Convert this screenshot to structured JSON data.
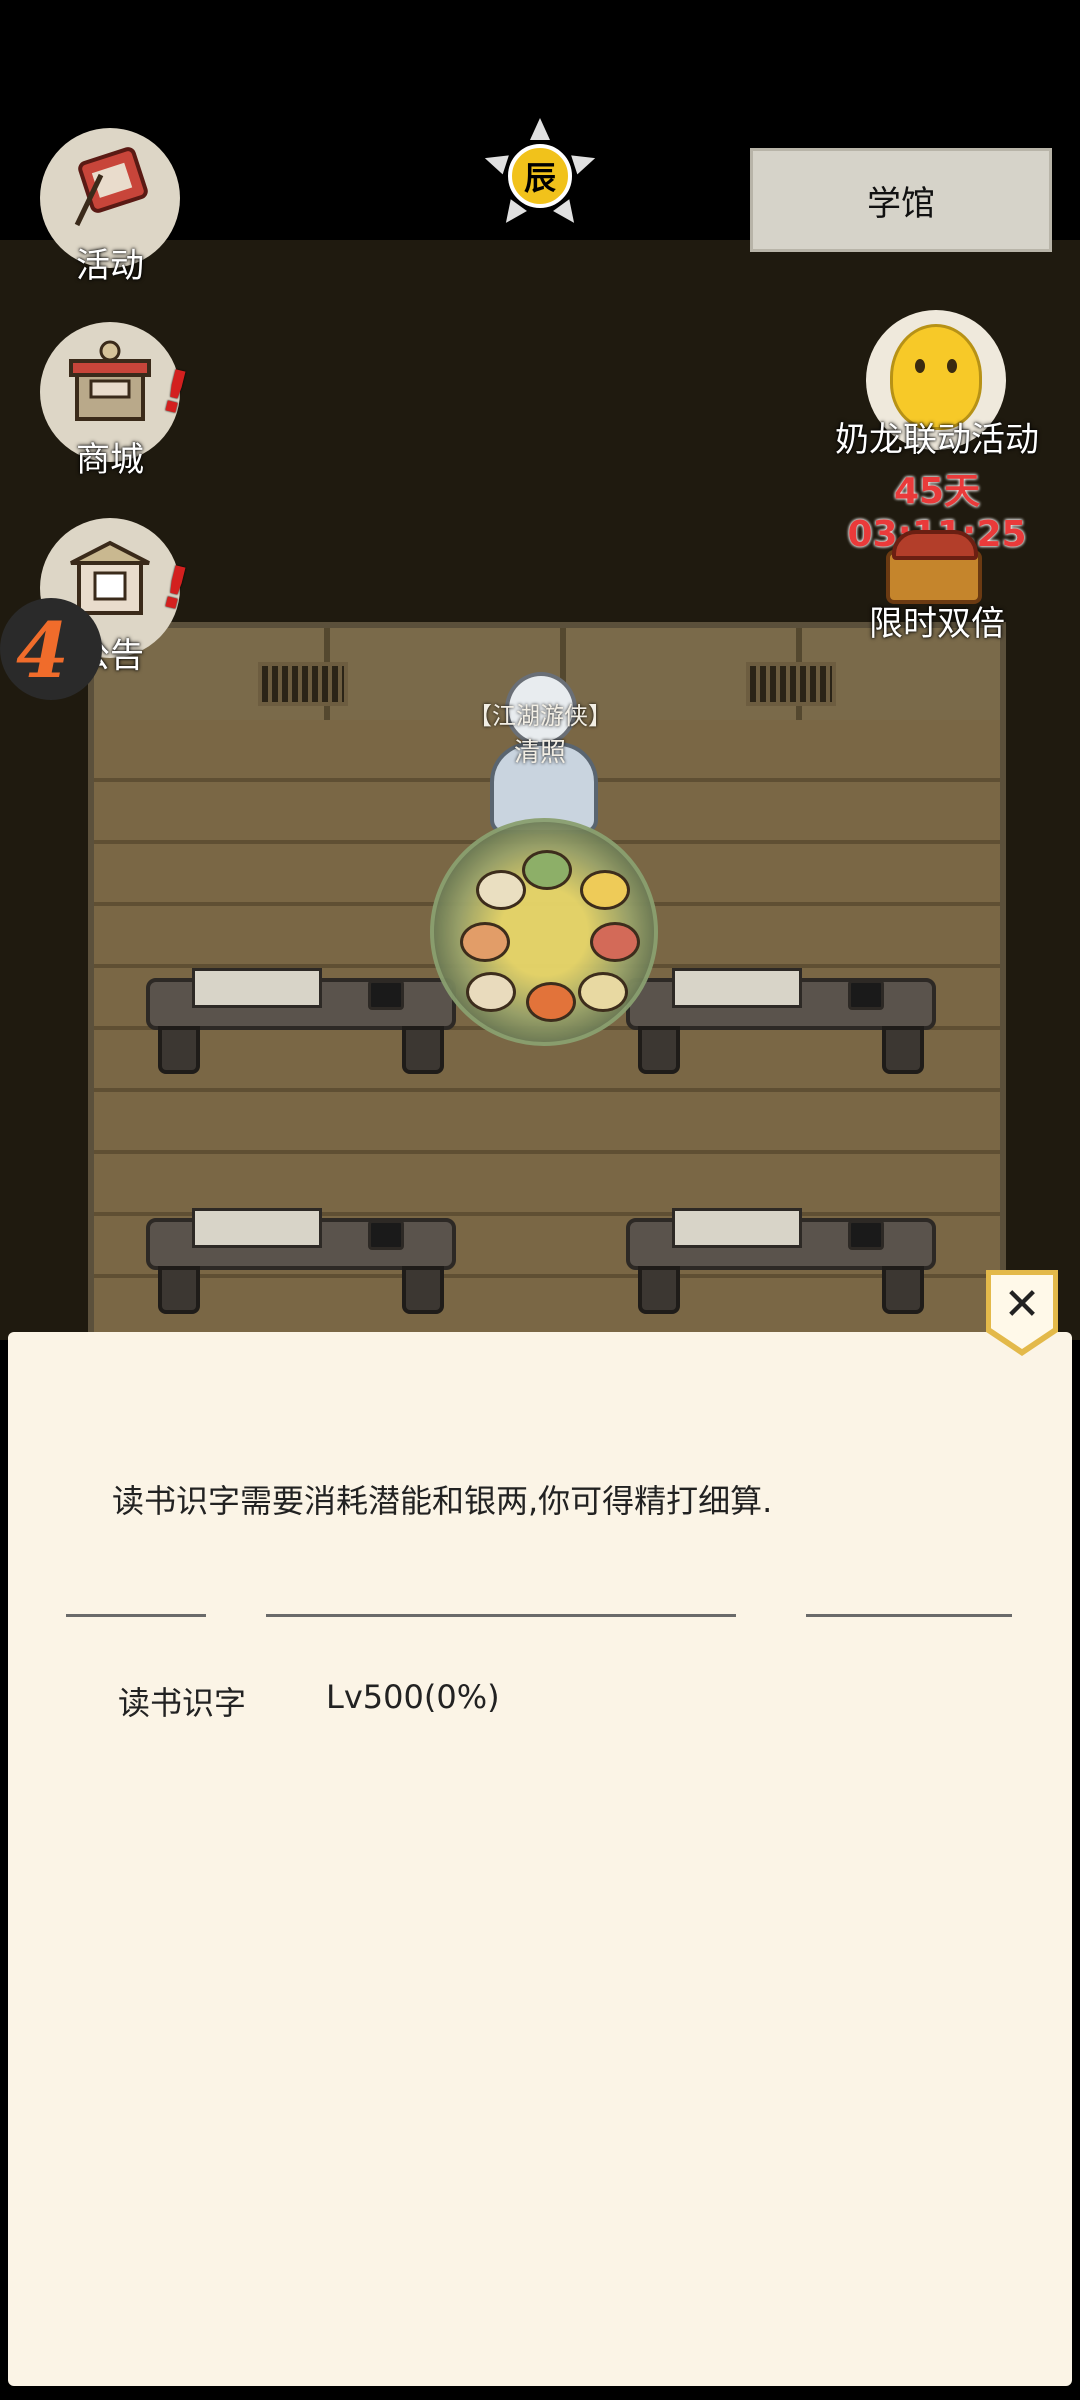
{
  "time_emblem": {
    "char": "辰"
  },
  "location_button": {
    "label": "学馆"
  },
  "side_menu": [
    {
      "label": "活动",
      "icon": "event-banner-icon"
    },
    {
      "label": "商城",
      "icon": "shop-stall-icon"
    },
    {
      "label": "公告",
      "icon": "notice-board-icon"
    }
  ],
  "float_logo": {
    "glyph": "4"
  },
  "promo": {
    "title": "奶龙联动活动",
    "timer": "45天03:11:25",
    "double_label": "限时双倍"
  },
  "npc": {
    "title": "【江湖游侠】",
    "name": "清照"
  },
  "panel": {
    "close": "✕",
    "description": "读书识字需要消耗潜能和银两,你可得精打细算.",
    "skill": {
      "name": "读书识字",
      "level": "Lv500(0%)"
    }
  },
  "colors": {
    "timer_red": "#ea3a3a",
    "panel_bg": "#fbf4e6",
    "close_border": "#e3b94a"
  }
}
